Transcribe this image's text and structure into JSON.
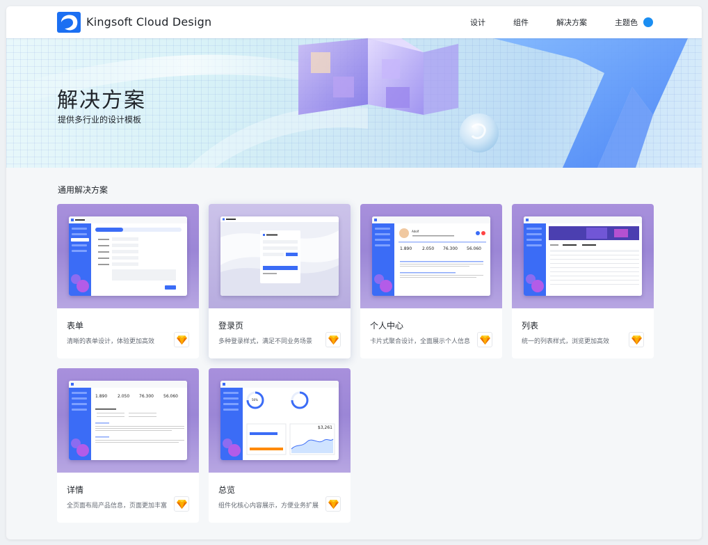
{
  "header": {
    "brand": "Kingsoft Cloud Design",
    "nav": [
      {
        "label": "设计"
      },
      {
        "label": "组件"
      },
      {
        "label": "解决方案"
      },
      {
        "label": "主题色"
      }
    ],
    "theme_color": "#1b8ef2"
  },
  "hero": {
    "title": "解决方案",
    "subtitle": "提供多行业的设计模板"
  },
  "section": {
    "title": "通用解决方案"
  },
  "cards": [
    {
      "title": "表单",
      "desc": "清晰的表单设计，体验更加高效",
      "icon": "sketch-icon"
    },
    {
      "title": "登录页",
      "desc": "多种登录样式，满足不同业务场景",
      "icon": "sketch-icon"
    },
    {
      "title": "个人中心",
      "desc": "卡片式聚合设计，全面展示个人信息",
      "icon": "sketch-icon"
    },
    {
      "title": "列表",
      "desc": "统一的列表样式，浏览更加高效",
      "icon": "sketch-icon"
    },
    {
      "title": "详情",
      "desc": "全页面布局产品信息，页面更加丰富",
      "icon": "sketch-icon"
    },
    {
      "title": "总览",
      "desc": "组件化核心内容展示，方便业务扩展",
      "icon": "sketch-icon"
    }
  ],
  "thumbs": {
    "brand": "KingDesign",
    "profile_name": "Adolf",
    "stats": [
      "1.890",
      "2.050",
      "76.300",
      "56.060"
    ],
    "overview_values": [
      "$3,261",
      "56%"
    ]
  },
  "colors": {
    "accent": "#3b6cf6",
    "card_bg": "#a890dc"
  }
}
